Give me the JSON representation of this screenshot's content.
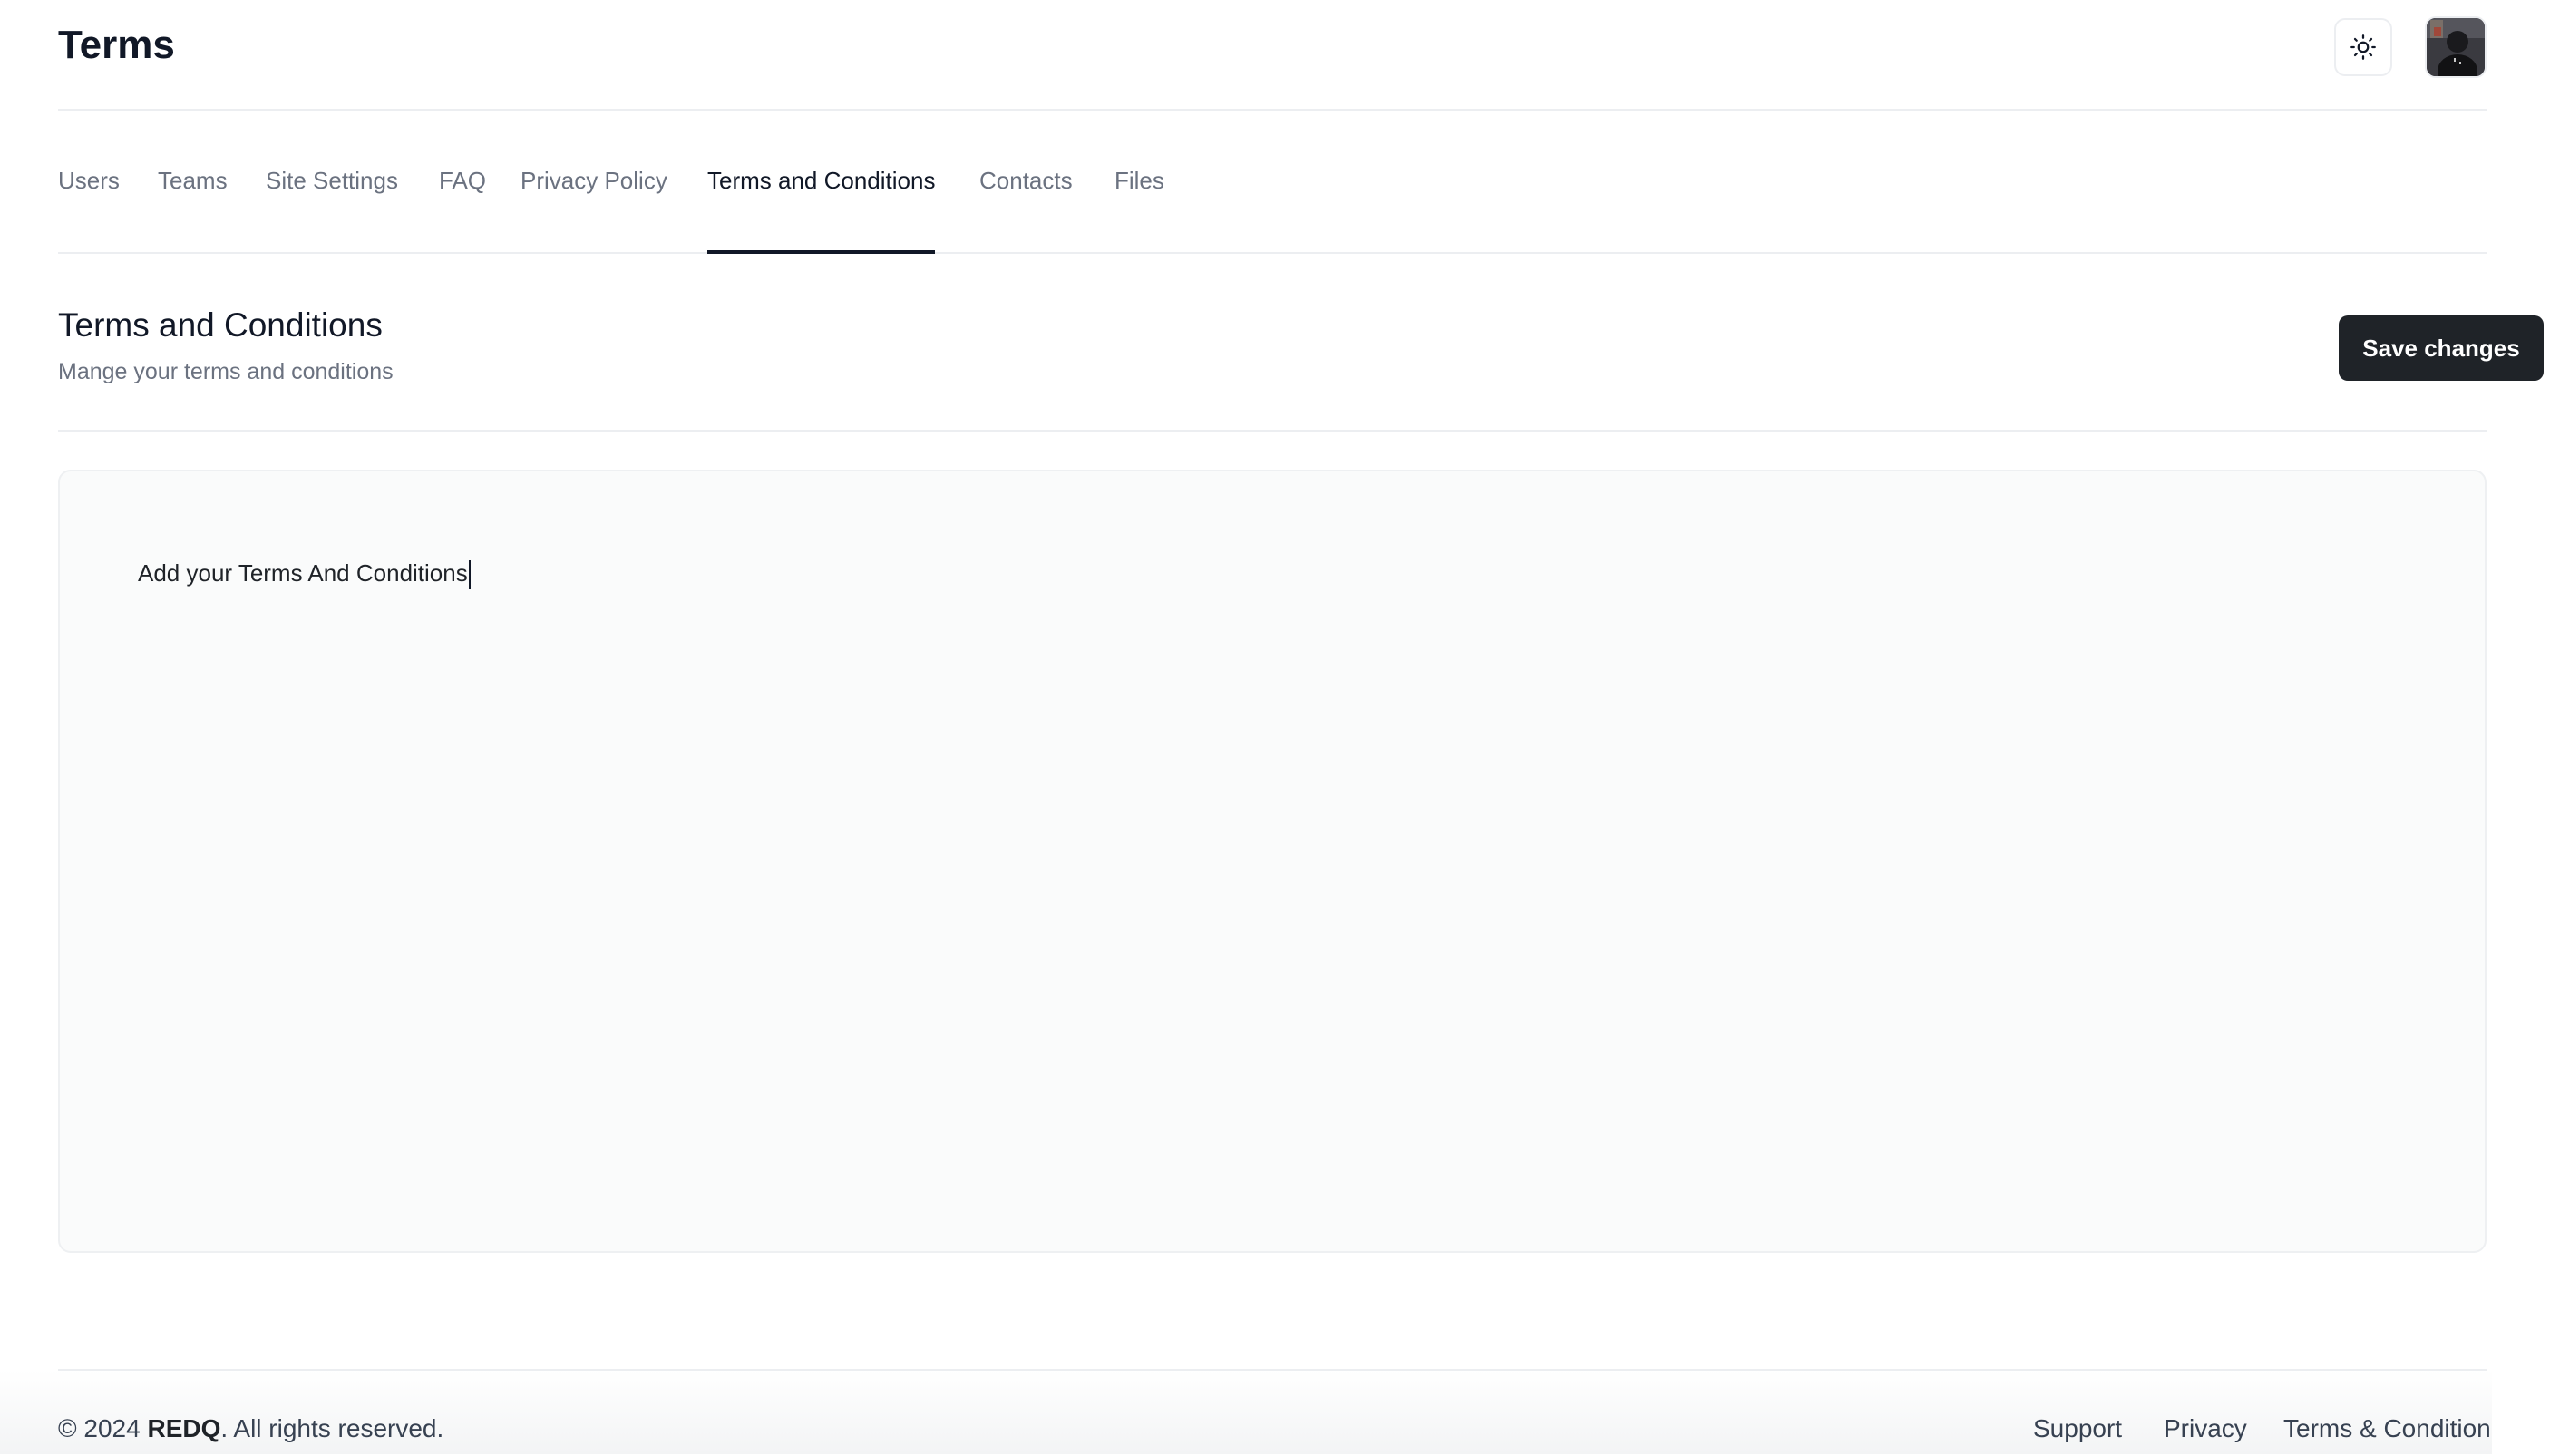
{
  "header": {
    "title": "Terms",
    "theme_toggle_icon": "sun-icon",
    "avatar_icon": "user-avatar"
  },
  "tabs": [
    {
      "label": "Users",
      "active": false
    },
    {
      "label": "Teams",
      "active": false
    },
    {
      "label": "Site Settings",
      "active": false
    },
    {
      "label": "FAQ",
      "active": false
    },
    {
      "label": "Privacy Policy",
      "active": false
    },
    {
      "label": "Terms and Conditions",
      "active": true
    },
    {
      "label": "Contacts",
      "active": false
    },
    {
      "label": "Files",
      "active": false
    }
  ],
  "section": {
    "title": "Terms and Conditions",
    "subtitle": "Mange your terms and conditions",
    "save_label": "Save changes"
  },
  "editor": {
    "content": "Add your Terms And Conditions"
  },
  "footer": {
    "copyright_prefix": "© 2024",
    "brand": "REDQ",
    "copyright_suffix": ". All rights reserved.",
    "links": [
      "Support",
      "Privacy",
      "Terms & Condition"
    ]
  },
  "colors": {
    "primary_button": "#1f2328",
    "active_tab": "#111827",
    "muted_text": "#6b7280",
    "border": "#eceef1",
    "editor_bg": "#fafbfb"
  }
}
